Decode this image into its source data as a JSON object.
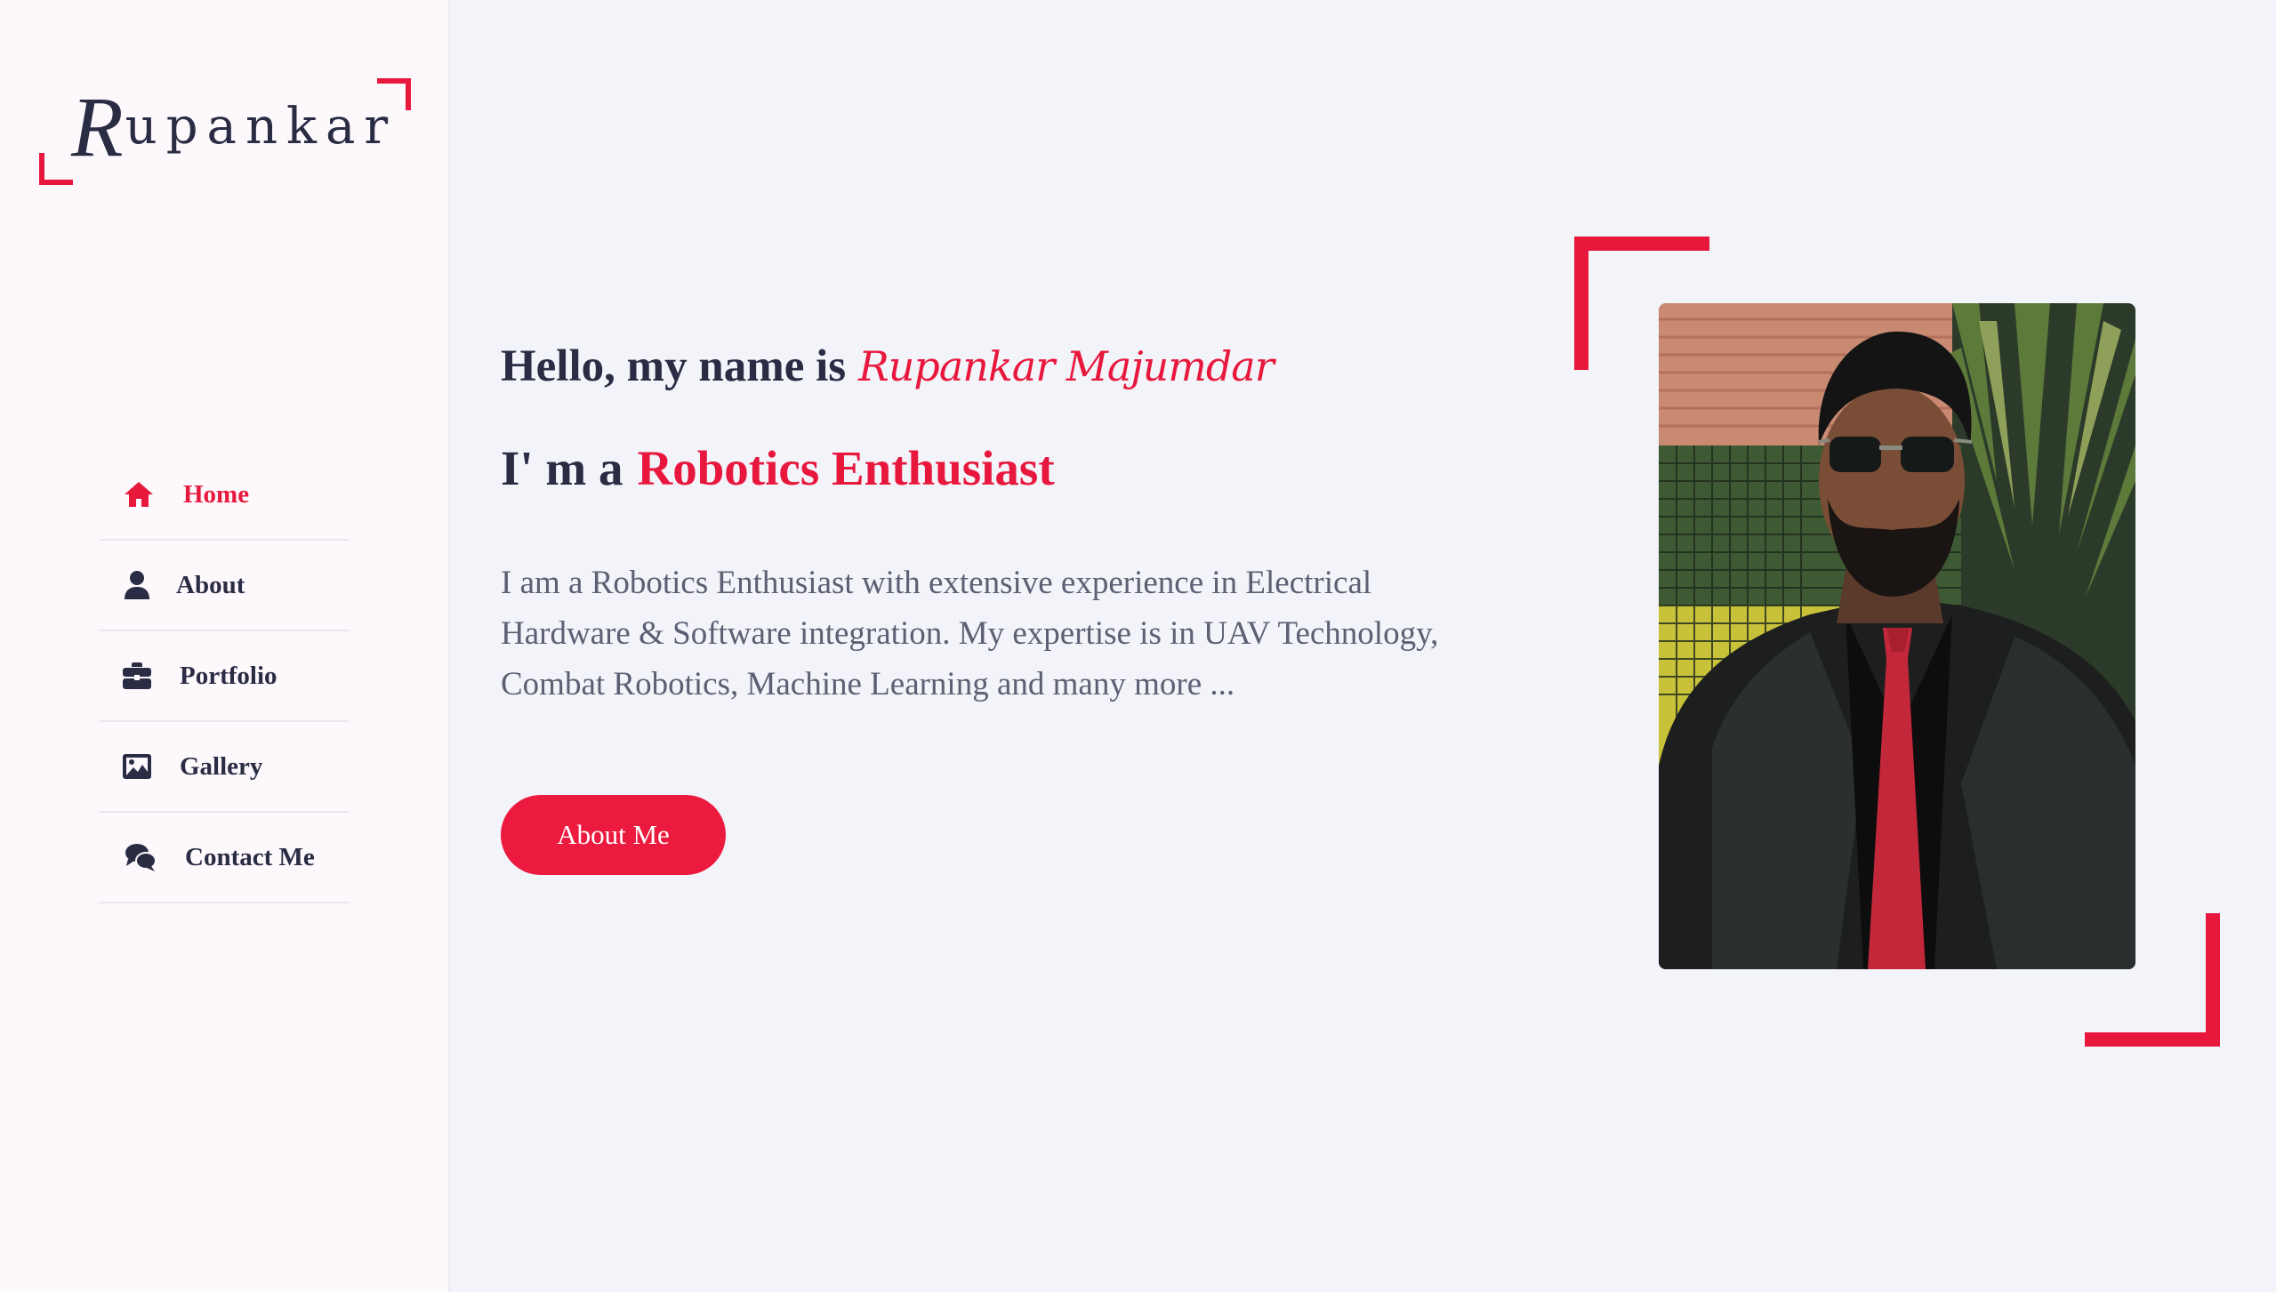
{
  "logo": {
    "first_letter": "R",
    "rest": "upankar"
  },
  "nav": {
    "items": [
      {
        "label": "Home",
        "icon": "home-icon",
        "active": true
      },
      {
        "label": "About",
        "icon": "user-icon",
        "active": false
      },
      {
        "label": "Portfolio",
        "icon": "briefcase-icon",
        "active": false
      },
      {
        "label": "Gallery",
        "icon": "image-icon",
        "active": false
      },
      {
        "label": "Contact Me",
        "icon": "comments-icon",
        "active": false
      }
    ]
  },
  "hero": {
    "greeting": "Hello, my name is",
    "name": "Rupankar Majumdar",
    "role_prefix": "I' m a",
    "role": "Robotics Enthusiast",
    "description": "I am a Robotics Enthusiast with extensive experience in Electrical Hardware & Software integration. My expertise is in UAV Technology, Combat Robotics, Machine Learning and many more ...",
    "button_label": "About Me"
  },
  "colors": {
    "accent": "#e8183d",
    "text_dark": "#2a2c44",
    "text_muted": "#5d5f72",
    "background": "#f3f3fa",
    "sidebar_background": "#fcf8fc"
  }
}
